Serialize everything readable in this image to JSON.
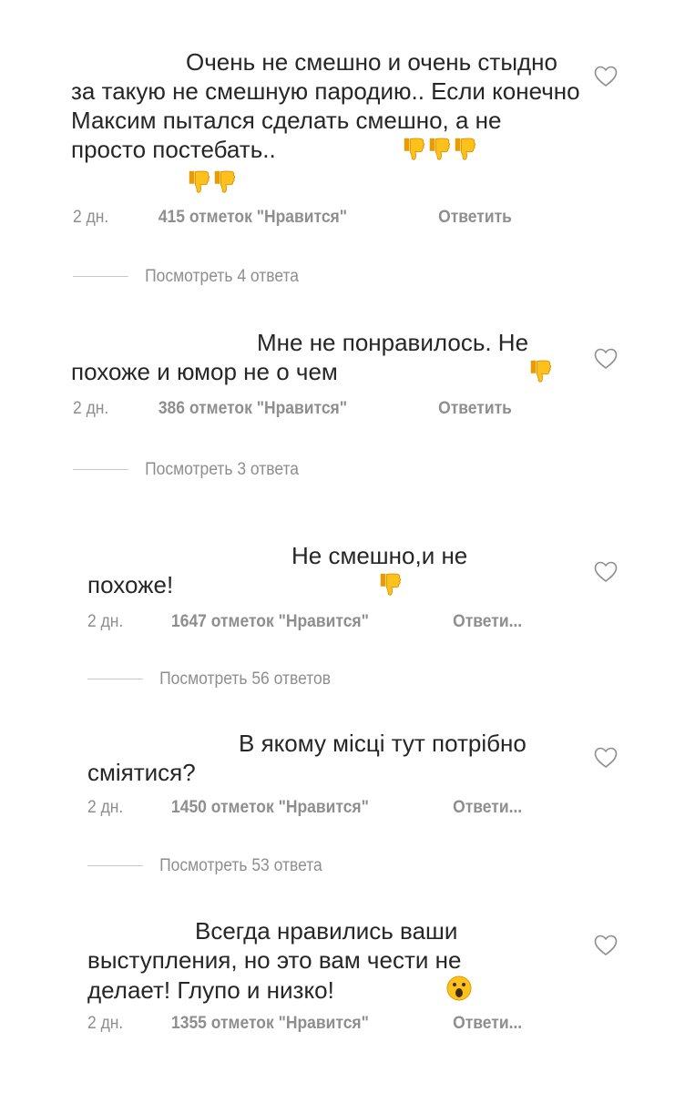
{
  "comments": [
    {
      "text": "Очень не смешно и очень стыдно за такую не смешную пародию.. Если конечно Максим пытался сделать смешно, а не просто постебать..",
      "emoji": "👎👎👎👎👎",
      "time": "2 дн.",
      "likes": "415 отметок \"Нравится\"",
      "reply": "Ответить",
      "view_replies": "Посмотреть 4 ответа"
    },
    {
      "text": "Мне не понравилось. Не похоже и юмор не о чем",
      "emoji": "👎",
      "time": "2 дн.",
      "likes": "386 отметок \"Нравится\"",
      "reply": "Ответить",
      "view_replies": "Посмотреть 3 ответа"
    },
    {
      "text": "Не смешно,и не похоже!",
      "emoji": "👎",
      "time": "2 дн.",
      "likes": "1647 отметок \"Нравится\"",
      "reply": "Ответи...",
      "view_replies": "Посмотреть 56 ответов"
    },
    {
      "text": "В якому місці тут потрібно сміятися?",
      "emoji": "",
      "time": "2 дн.",
      "likes": "1450 отметок \"Нравится\"",
      "reply": "Ответи...",
      "view_replies": "Посмотреть 53 ответа"
    },
    {
      "text": "Всегда нравились ваши выступления, но это вам чести не делает! Глупо и низко!",
      "emoji": "😮",
      "time": "2 дн.",
      "likes": "1355 отметок \"Нравится\"",
      "reply": "Ответи...",
      "view_replies": ""
    }
  ],
  "icons": {
    "like": "heart-outline-icon",
    "thumbs": "thumbs-down-icon",
    "surprised": "face-open-mouth-icon"
  },
  "colors": {
    "text": "#262626",
    "secondary": "#8e8e8e",
    "emoji": "#f7b500"
  }
}
